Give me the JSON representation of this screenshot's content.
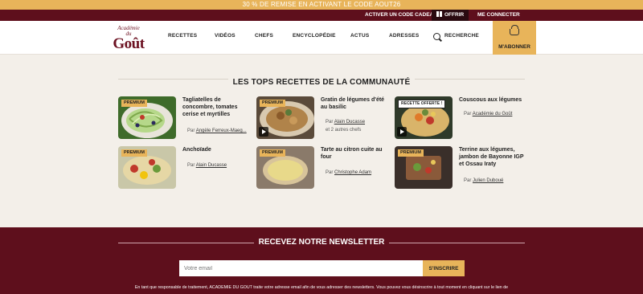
{
  "promo": {
    "text": "30 % DE REMISE EN ACTIVANT LE CODE AOUT26"
  },
  "topbar": {
    "activate_code": "ACTIVER UN CODE CADEAU",
    "offer": "OFFRIR",
    "login": "ME CONNECTER"
  },
  "logo": {
    "line1": "Académie",
    "line2": "du",
    "line3": "Goût"
  },
  "nav": {
    "items": [
      "RECETTES",
      "VIDÉOS",
      "CHEFS",
      "ENCYCLOPÉDIE",
      "ACTUS",
      "ADRESSES"
    ],
    "search_label": "RECHERCHE",
    "subscribe_label": "M'ABONNER"
  },
  "section": {
    "title": "LES TOPS RECETTES DE LA COMMUNAUTÉ"
  },
  "recipes": [
    {
      "title": "Tagliatelles de concombre, tomates cerise et myrtilles",
      "badge": "PREMIUM",
      "by": "Par",
      "author": "Angèle Ferreux-Maeg...",
      "extra": ""
    },
    {
      "title": "Gratin de légumes d'été au basilic",
      "badge": "PREMIUM",
      "by": "Par",
      "author": "Alain Ducasse",
      "extra": "et 2 autres chefs"
    },
    {
      "title": "Couscous aux légumes",
      "badge": "RECETTE OFFERTE !",
      "by": "Par",
      "author": "Académie du Goût",
      "extra": ""
    },
    {
      "title": "Anchoïade",
      "badge": "PREMIUM",
      "by": "Par",
      "author": "Alain Ducasse",
      "extra": ""
    },
    {
      "title": "Tarte au citron cuite au four",
      "badge": "PREMIUM",
      "by": "Par",
      "author": "Christophe Adam",
      "extra": ""
    },
    {
      "title": "Terrine aux légumes, jambon de Bayonne IGP et Ossau Iraty",
      "badge": "PREMIUM",
      "by": "Par",
      "author": "Julien Duboué",
      "extra": ""
    }
  ],
  "newsletter": {
    "title": "RECEVEZ NOTRE NEWSLETTER",
    "placeholder": "Votre email",
    "button": "S'INSCRIRE",
    "legal": "En tant que responsable de traitement, ACADEMIE DU GOUT traite votre adresse email afin de vous adresser des newsletters. Vous pouvez vous désinscrire à tout moment en cliquant sur le lien de"
  },
  "colors": {
    "burgundy": "#5e0f1c",
    "gold": "#e8b45a",
    "background": "#f3efe9"
  },
  "icons": [
    "gift-icon",
    "search-icon",
    "basket-icon",
    "play-icon"
  ]
}
